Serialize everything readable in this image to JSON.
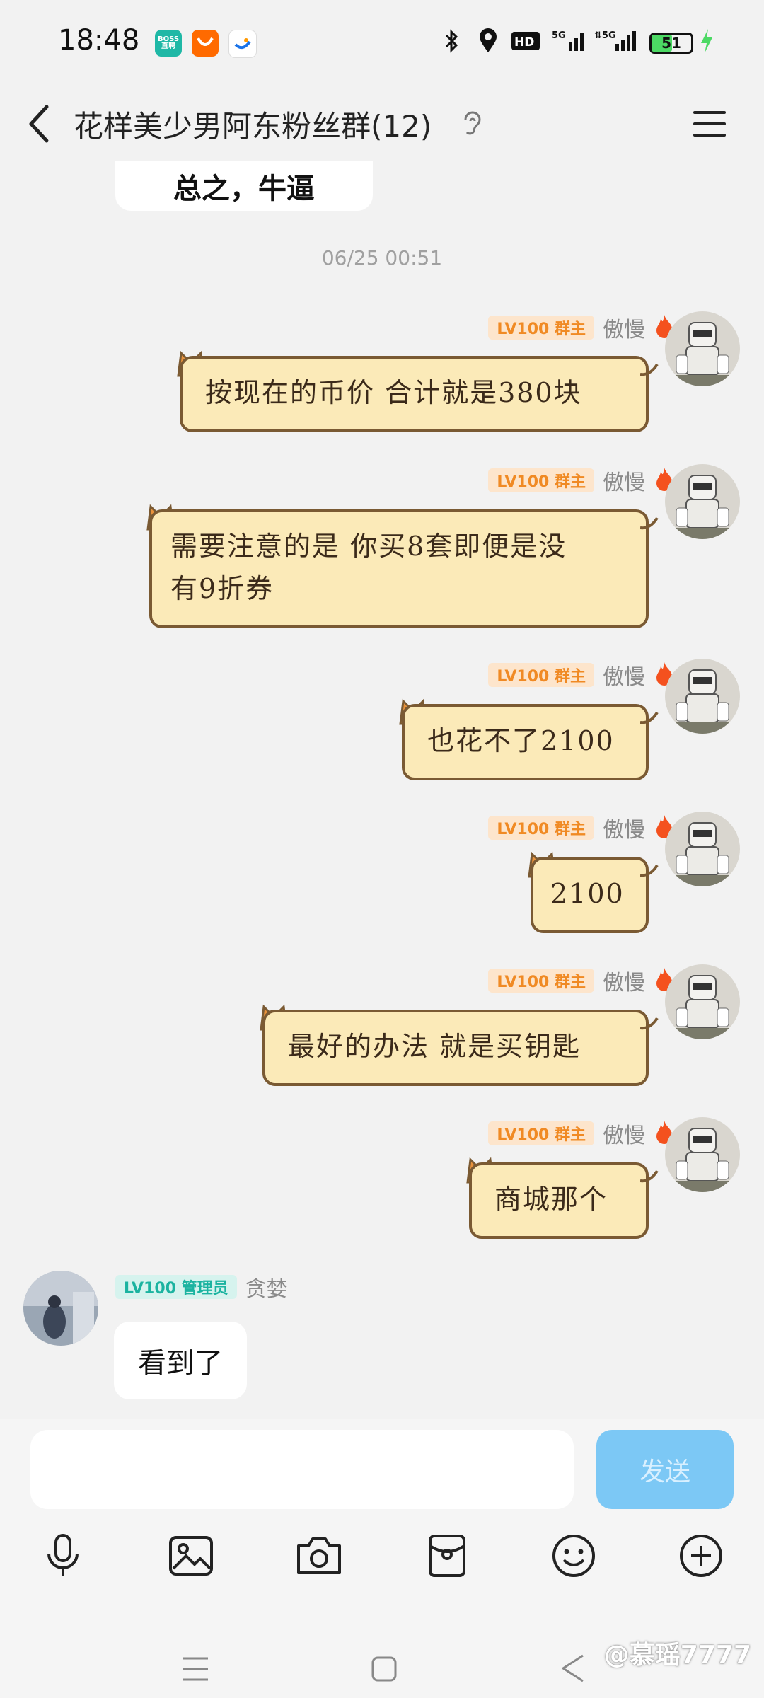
{
  "status_bar": {
    "time": "18:48",
    "apps": [
      {
        "name": "boss-zhipin-icon",
        "label": "BOSS\n直聘",
        "color": "#1fb8a6"
      },
      {
        "name": "meituan-icon",
        "label": "",
        "color": "#ff6a00"
      },
      {
        "name": "app-icon",
        "label": "",
        "color": "#1a73e8"
      }
    ],
    "network": "5G",
    "network2": "5G",
    "hd_label": "HD",
    "battery": "51",
    "battery_level": 0.51
  },
  "header": {
    "title": "花样美少男阿东粉丝群(12)"
  },
  "chat": {
    "previous_message": "总之，牛逼",
    "timestamp": "06/25 00:51",
    "messages": [
      {
        "badge": "LV100 群主",
        "sender": "傲慢",
        "text_lines": [
          "按现在的币价 合计就是380块"
        ]
      },
      {
        "badge": "LV100 群主",
        "sender": "傲慢",
        "text_lines": [
          "需要注意的是 你买8套即便是没",
          "有9折券"
        ]
      },
      {
        "badge": "LV100 群主",
        "sender": "傲慢",
        "text_lines": [
          "也花不了2100"
        ]
      },
      {
        "badge": "LV100 群主",
        "sender": "傲慢",
        "text_lines": [
          "2100"
        ]
      },
      {
        "badge": "LV100 群主",
        "sender": "傲慢",
        "text_lines": [
          "最好的办法 就是买钥匙"
        ]
      },
      {
        "badge": "LV100 群主",
        "sender": "傲慢",
        "text_lines": [
          "商城那个"
        ]
      }
    ],
    "reply": {
      "badge": "LV100 管理员",
      "sender": "贪婪",
      "text": "看到了"
    }
  },
  "input": {
    "placeholder": "",
    "send_label": "发送"
  },
  "toolbar": [
    "microphone-icon",
    "image-icon",
    "camera-icon",
    "red-packet-icon",
    "emoji-icon",
    "plus-icon"
  ],
  "watermark": "@慕瑶7777",
  "colors": {
    "owner_badge_bg": "#fde5cc",
    "owner_badge_text": "#f08a24",
    "admin_badge_bg": "#d6f3ee",
    "admin_badge_text": "#1bb3a0",
    "cat_bubble": "#fbeab8",
    "send_button": "#7cc8f5"
  }
}
